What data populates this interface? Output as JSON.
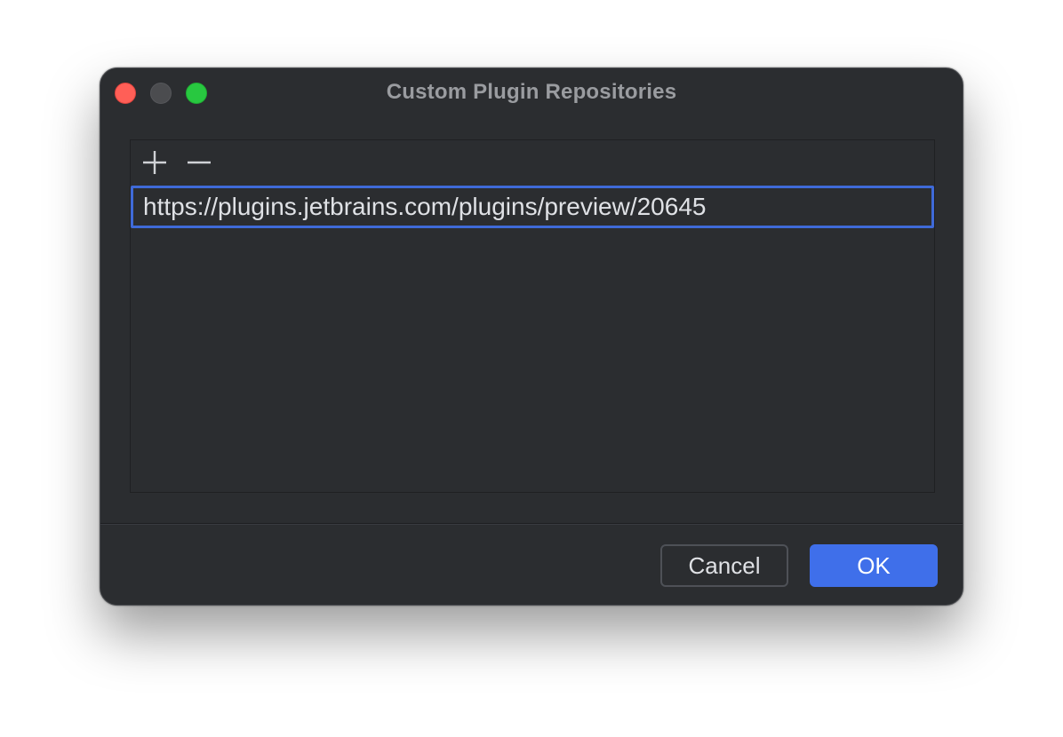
{
  "window": {
    "title": "Custom Plugin Repositories",
    "controls": {
      "close_color": "#ff5f57",
      "minimize_color": "#4b4c4f",
      "zoom_color": "#28c840"
    }
  },
  "toolbar": {
    "add_icon": "plus-icon",
    "remove_icon": "minus-icon"
  },
  "repositories": {
    "items": [
      {
        "url": "https://plugins.jetbrains.com/plugins/preview/20645",
        "editing": true
      }
    ]
  },
  "footer": {
    "cancel_label": "Cancel",
    "ok_label": "OK"
  },
  "colors": {
    "background": "#2b2d30",
    "accent": "#3f6fea",
    "text": "#dfe1e5",
    "title": "#9a9ca0"
  }
}
